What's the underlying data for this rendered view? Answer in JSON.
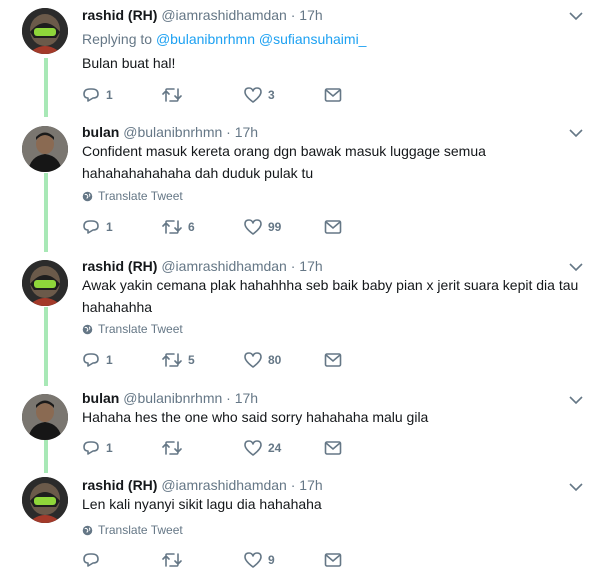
{
  "tweets": [
    {
      "name": "rashid (RH)",
      "handle": "@iamrashidhamdan",
      "dot": "·",
      "time": "17h",
      "replying_prefix": "Replying to",
      "replying_to_1": "@bulanibnrhmn",
      "replying_to_2": "@sufiansuhaimi_",
      "text": "Bulan buat hal!",
      "replies": "1",
      "retweets": "",
      "likes": "3"
    },
    {
      "name": "bulan",
      "handle": "@bulanibnrhmn",
      "dot": "·",
      "time": "17h",
      "text_line1": "Confident masuk kereta orang dgn bawak masuk luggage semua",
      "text_line2": "hahahahahahaha dah duduk pulak tu",
      "translate": "Translate Tweet",
      "replies": "1",
      "retweets": "6",
      "likes": "99"
    },
    {
      "name": "rashid (RH)",
      "handle": "@iamrashidhamdan",
      "dot": "·",
      "time": "17h",
      "text_line1": "Awak yakin cemana plak hahahhha seb baik baby pian x jerit suara kepit dia tau",
      "text_line2": "hahahahha",
      "translate": "Translate Tweet",
      "replies": "1",
      "retweets": "5",
      "likes": "80"
    },
    {
      "name": "bulan",
      "handle": "@bulanibnrhmn",
      "dot": "·",
      "time": "17h",
      "text": "Hahaha hes the one who said sorry hahahaha malu gila",
      "replies": "1",
      "retweets": "",
      "likes": "24"
    },
    {
      "name": "rashid (RH)",
      "handle": "@iamrashidhamdan",
      "dot": "·",
      "time": "17h",
      "text": "Len kali nyanyi sikit lagu dia hahahaha",
      "translate": "Translate Tweet",
      "replies": "",
      "retweets": "",
      "likes": "9"
    }
  ],
  "colors": {
    "thread_line": "#a8e8b6",
    "mention": "#1da1f2",
    "muted": "#657786",
    "text": "#14171a"
  },
  "icons": {
    "reply": "reply-icon",
    "retweet": "retweet-icon",
    "like": "heart-icon",
    "message": "envelope-icon",
    "chevron": "chevron-down-icon",
    "globe": "globe-icon"
  }
}
